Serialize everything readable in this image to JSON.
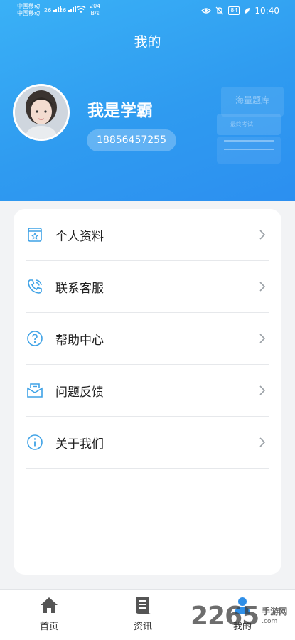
{
  "status_bar": {
    "carrier1": "中国移动",
    "carrier2": "中国移动",
    "net1": "26",
    "net2": "26",
    "speed_value": "204",
    "speed_unit": "B/s",
    "battery": "84",
    "time": "10:40"
  },
  "header": {
    "title": "我的",
    "username": "我是学霸",
    "phone": "18856457255",
    "deco_back_text": "海量题库",
    "deco_mid_text": "最终考试"
  },
  "menu": {
    "items": [
      {
        "label": "个人资料",
        "icon": "profile-card-icon"
      },
      {
        "label": "联系客服",
        "icon": "phone-icon"
      },
      {
        "label": "帮助中心",
        "icon": "question-icon"
      },
      {
        "label": "问题反馈",
        "icon": "feedback-mail-icon"
      },
      {
        "label": "关于我们",
        "icon": "info-icon"
      }
    ]
  },
  "tabbar": {
    "tabs": [
      {
        "label": "首页",
        "icon": "home-icon"
      },
      {
        "label": "资讯",
        "icon": "news-icon"
      },
      {
        "label": "我的",
        "icon": "user-icon",
        "active": true
      }
    ]
  },
  "watermark": {
    "number": "2265",
    "text": "手游网",
    "url": ".com"
  },
  "colors": {
    "header_start": "#3ab1f6",
    "header_end": "#2c8ff0",
    "icon_accent": "#3ea2e6"
  }
}
